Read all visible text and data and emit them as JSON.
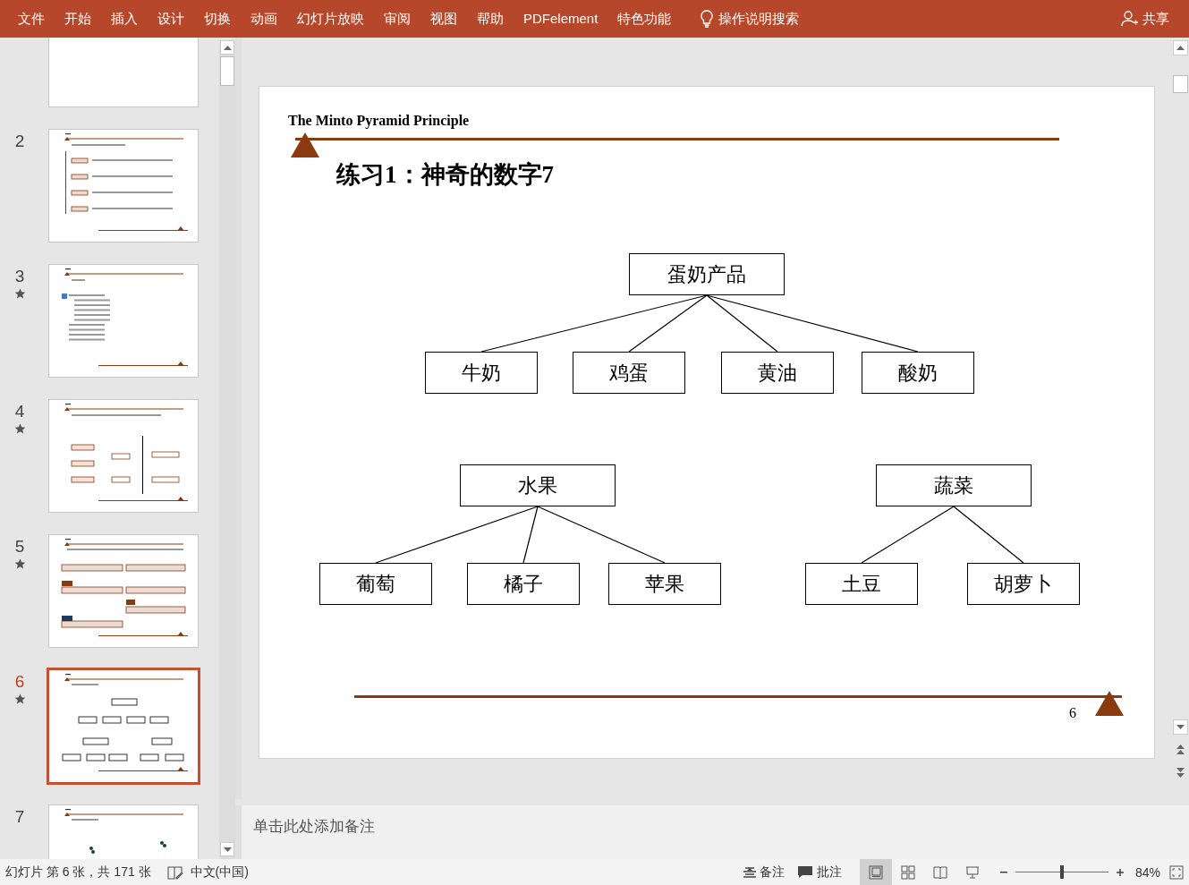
{
  "ribbon": {
    "tabs": [
      "文件",
      "开始",
      "插入",
      "设计",
      "切换",
      "动画",
      "幻灯片放映",
      "审阅",
      "视图",
      "帮助",
      "PDFelement",
      "特色功能"
    ],
    "search": "操作说明搜索",
    "share": "共享"
  },
  "slides_pane": {
    "thumbnails": [
      {
        "kind": "title",
        "starred": false,
        "selected": false
      },
      {
        "number": "2",
        "kind": "timeline",
        "starred": false,
        "selected": false
      },
      {
        "number": "3",
        "kind": "list",
        "starred": true,
        "selected": false
      },
      {
        "number": "4",
        "kind": "diagram",
        "starred": true,
        "selected": false
      },
      {
        "number": "5",
        "kind": "flow",
        "starred": true,
        "selected": false
      },
      {
        "number": "6",
        "kind": "tree",
        "starred": true,
        "selected": true
      },
      {
        "number": "7",
        "kind": "dots",
        "starred": false,
        "selected": false
      }
    ]
  },
  "slide": {
    "header": "The Minto Pyramid Principle",
    "title": "练习1：神奇的数字7",
    "page_number": "6",
    "trees": [
      {
        "label": "蛋奶产品",
        "children": [
          {
            "label": "牛奶"
          },
          {
            "label": "鸡蛋"
          },
          {
            "label": "黄油"
          },
          {
            "label": "酸奶"
          }
        ]
      },
      {
        "label": "水果",
        "children": [
          {
            "label": "葡萄"
          },
          {
            "label": "橘子"
          },
          {
            "label": "苹果"
          }
        ]
      },
      {
        "label": "蔬菜",
        "children": [
          {
            "label": "土豆"
          },
          {
            "label": "胡萝卜"
          }
        ]
      }
    ]
  },
  "notes": {
    "prompt": "单击此处添加备注"
  },
  "status_bar": {
    "slide_info": "幻灯片 第 6 张，共 171 张",
    "language": "中文(中国)",
    "notes_button": "备注",
    "comments_button": "批注",
    "views": [
      {
        "kind": "normal",
        "selected": true
      },
      {
        "kind": "sorter",
        "selected": false
      },
      {
        "kind": "reading",
        "selected": false
      },
      {
        "kind": "slideshow",
        "selected": false
      }
    ],
    "zoom": {
      "level": 0.5,
      "reading": "84%"
    }
  }
}
